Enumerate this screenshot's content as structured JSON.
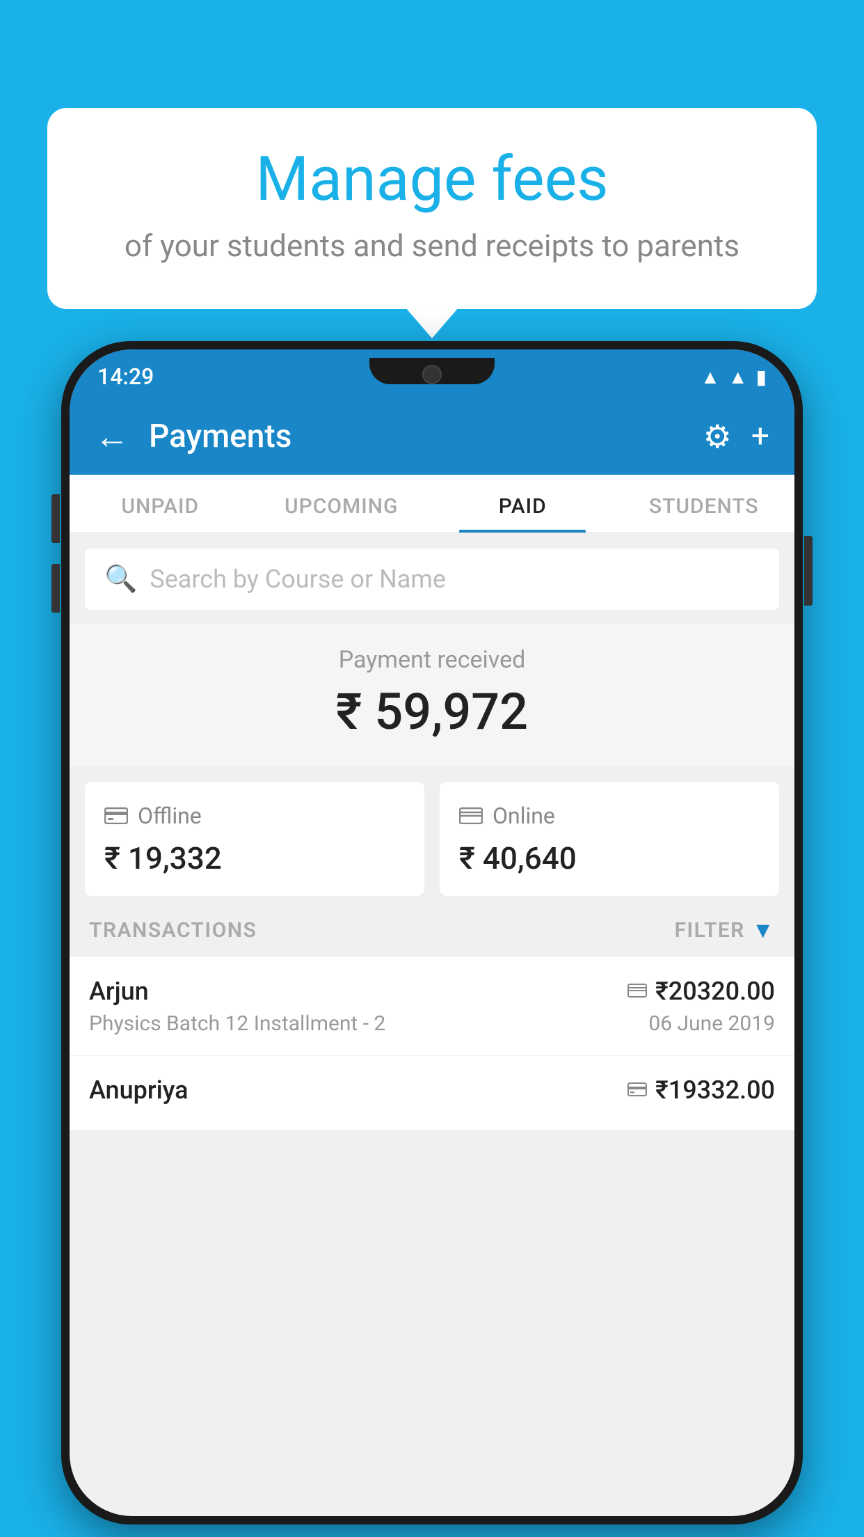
{
  "background_color": "#1ab0e8",
  "speech_bubble": {
    "title": "Manage fees",
    "subtitle": "of your students and send receipts to parents"
  },
  "status_bar": {
    "time": "14:29",
    "icons": [
      "wifi",
      "signal",
      "battery"
    ]
  },
  "app_bar": {
    "title": "Payments",
    "back_label": "←",
    "settings_label": "⚙",
    "add_label": "+"
  },
  "tabs": [
    {
      "label": "UNPAID",
      "active": false
    },
    {
      "label": "UPCOMING",
      "active": false
    },
    {
      "label": "PAID",
      "active": true
    },
    {
      "label": "STUDENTS",
      "active": false
    }
  ],
  "search": {
    "placeholder": "Search by Course or Name"
  },
  "payment_received": {
    "label": "Payment received",
    "amount": "₹ 59,972"
  },
  "payment_cards": [
    {
      "type": "Offline",
      "amount": "₹ 19,332",
      "icon": "💴"
    },
    {
      "type": "Online",
      "amount": "₹ 40,640",
      "icon": "💳"
    }
  ],
  "transactions_section": {
    "label": "TRANSACTIONS",
    "filter_label": "FILTER"
  },
  "transactions": [
    {
      "name": "Arjun",
      "course": "Physics Batch 12 Installment - 2",
      "date": "06 June 2019",
      "amount": "₹20320.00",
      "type": "online"
    },
    {
      "name": "Anupriya",
      "course": "",
      "date": "",
      "amount": "₹19332.00",
      "type": "offline"
    }
  ]
}
